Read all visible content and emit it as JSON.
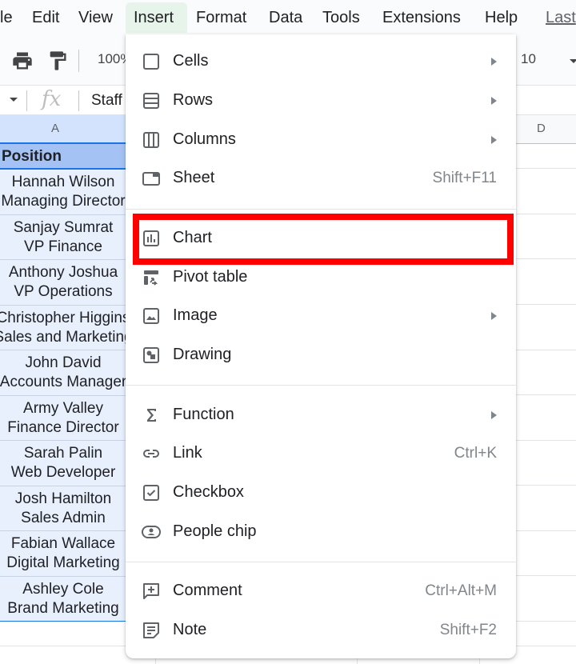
{
  "menubar": {
    "items": [
      {
        "label": "le",
        "name": "file"
      },
      {
        "label": "Edit",
        "name": "edit"
      },
      {
        "label": "View",
        "name": "view"
      },
      {
        "label": "Insert",
        "name": "insert",
        "active": true
      },
      {
        "label": "Format",
        "name": "format"
      },
      {
        "label": "Data",
        "name": "data"
      },
      {
        "label": "Tools",
        "name": "tools"
      },
      {
        "label": "Extensions",
        "name": "extensions"
      },
      {
        "label": "Help",
        "name": "help"
      }
    ],
    "last_edit": "Last"
  },
  "toolbar": {
    "zoom_value": "100%",
    "font_size": "10"
  },
  "formula_bar": {
    "fx_label": "fx",
    "content": "Staff"
  },
  "column_headers": [
    "A",
    "D"
  ],
  "sheet": {
    "header": "Position",
    "rows": [
      {
        "line1": "Hannah Wilson",
        "line2": "Managing Director"
      },
      {
        "line1": "Sanjay Sumrat",
        "line2": "VP Finance"
      },
      {
        "line1": "Anthony Joshua",
        "line2": "VP Operations"
      },
      {
        "line1": "Christopher Higgins",
        "line2": "Sales and Marketing"
      },
      {
        "line1": "John David",
        "line2": "Accounts Manager"
      },
      {
        "line1": "Army Valley",
        "line2": "Finance Director"
      },
      {
        "line1": "Sarah Palin",
        "line2": "Web Developer"
      },
      {
        "line1": "Josh Hamilton",
        "line2": "Sales Admin"
      },
      {
        "line1": "Fabian Wallace",
        "line2": "Digital Marketing"
      },
      {
        "line1": "Ashley Cole",
        "line2": "Brand Marketing"
      }
    ]
  },
  "insert_menu": {
    "items": [
      {
        "label": "Cells",
        "icon": "cells-icon",
        "submenu": true,
        "shortcut": ""
      },
      {
        "label": "Rows",
        "icon": "rows-icon",
        "submenu": true,
        "shortcut": ""
      },
      {
        "label": "Columns",
        "icon": "columns-icon",
        "submenu": true,
        "shortcut": ""
      },
      {
        "label": "Sheet",
        "icon": "sheet-icon",
        "submenu": false,
        "shortcut": "Shift+F11"
      },
      {
        "label": "Chart",
        "icon": "chart-icon",
        "submenu": false,
        "shortcut": "",
        "highlighted": true
      },
      {
        "label": "Pivot table",
        "icon": "pivot-table-icon",
        "submenu": false,
        "shortcut": ""
      },
      {
        "label": "Image",
        "icon": "image-icon",
        "submenu": true,
        "shortcut": ""
      },
      {
        "label": "Drawing",
        "icon": "drawing-icon",
        "submenu": false,
        "shortcut": ""
      },
      {
        "label": "Function",
        "icon": "sigma-icon",
        "submenu": true,
        "shortcut": ""
      },
      {
        "label": "Link",
        "icon": "link-icon",
        "submenu": false,
        "shortcut": "Ctrl+K"
      },
      {
        "label": "Checkbox",
        "icon": "checkbox-icon",
        "submenu": false,
        "shortcut": ""
      },
      {
        "label": "People chip",
        "icon": "people-chip-icon",
        "submenu": false,
        "shortcut": ""
      },
      {
        "label": "Comment",
        "icon": "comment-icon",
        "submenu": false,
        "shortcut": "Ctrl+Alt+M"
      },
      {
        "label": "Note",
        "icon": "note-icon",
        "submenu": false,
        "shortcut": "Shift+F2"
      }
    ]
  },
  "colors": {
    "highlight_box": "#ff0000",
    "active_menu_bg": "#e6f4ea",
    "selected_cell_bg": "#e8f0fe",
    "header_cell_bg": "#a4c2f4"
  }
}
